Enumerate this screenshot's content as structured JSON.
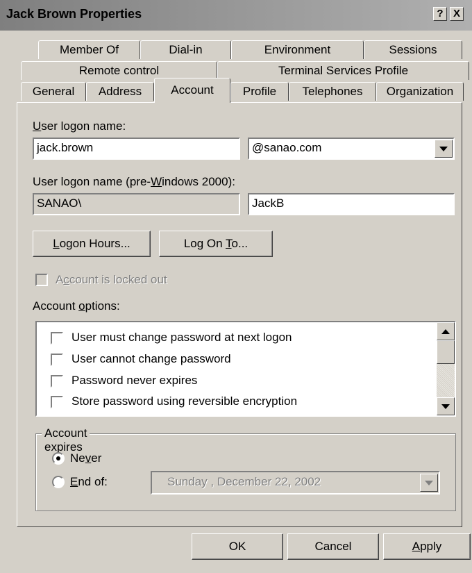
{
  "window": {
    "title": "Jack Brown Properties",
    "help_button": "?",
    "close_button": "X"
  },
  "tabs": {
    "row1": [
      {
        "label": "Member Of"
      },
      {
        "label": "Dial-in"
      },
      {
        "label": "Environment"
      },
      {
        "label": "Sessions"
      }
    ],
    "row2": [
      {
        "label": "Remote control"
      },
      {
        "label": "Terminal Services Profile"
      }
    ],
    "row3": [
      {
        "label": "General"
      },
      {
        "label": "Address"
      },
      {
        "label": "Account",
        "active": true
      },
      {
        "label": "Profile"
      },
      {
        "label": "Telephones"
      },
      {
        "label": "Organization"
      }
    ]
  },
  "account": {
    "logon_name_label_pre": "",
    "logon_name_label_u": "U",
    "logon_name_label_post": "ser logon name:",
    "logon_name_value": "jack.brown",
    "domain_value": "@sanao.com",
    "pre2000_label_pre": "User logon name (pre-",
    "pre2000_label_u": "W",
    "pre2000_label_post": "indows 2000):",
    "pre2000_domain": "SANAO\\",
    "pre2000_name": "JackB",
    "logon_hours_pre": "",
    "logon_hours_u": "L",
    "logon_hours_post": "ogon Hours...",
    "logon_to_pre": "Log On ",
    "logon_to_u": "T",
    "logon_to_post": "o...",
    "locked_pre": "A",
    "locked_u": "c",
    "locked_post": "count is locked out",
    "options_label_pre": "Account ",
    "options_label_u": "o",
    "options_label_post": "ptions:",
    "options": [
      {
        "label": "User must change password at next logon",
        "checked": false
      },
      {
        "label": "User cannot change password",
        "checked": false
      },
      {
        "label": "Password never expires",
        "checked": false
      },
      {
        "label": "Store password using reversible encryption",
        "checked": false
      }
    ],
    "expires_label": "Account expires",
    "never_pre": "Ne",
    "never_u": "v",
    "never_post": "er",
    "end_of_pre": "",
    "end_of_u": "E",
    "end_of_post": "nd of:",
    "end_date": "Sunday    , December 22, 2002"
  },
  "footer": {
    "ok": "OK",
    "cancel": "Cancel",
    "apply_u": "A",
    "apply_post": "pply"
  }
}
